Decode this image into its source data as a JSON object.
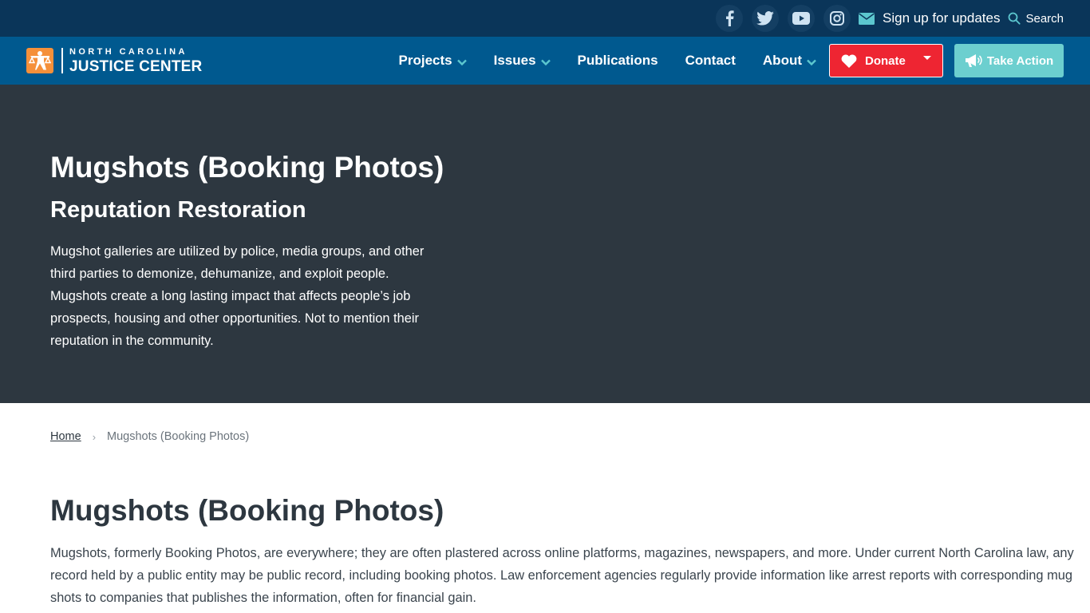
{
  "topbar": {
    "social": [
      {
        "name": "facebook-icon",
        "label": "Facebook"
      },
      {
        "name": "twitter-icon",
        "label": "Twitter"
      },
      {
        "name": "youtube-icon",
        "label": "YouTube"
      },
      {
        "name": "instagram-icon",
        "label": "Instagram"
      }
    ],
    "signup_label": "Sign up for updates",
    "search_label": "Search"
  },
  "header": {
    "logo_top": "NORTH CAROLINA",
    "logo_bottom": "JUSTICE CENTER",
    "nav": [
      {
        "label": "Projects",
        "dropdown": true
      },
      {
        "label": "Issues",
        "dropdown": true
      },
      {
        "label": "Publications",
        "dropdown": false
      },
      {
        "label": "Contact",
        "dropdown": false
      },
      {
        "label": "About",
        "dropdown": true
      }
    ],
    "donate_label": "Donate",
    "take_action_label": "Take Action",
    "colors": {
      "donate": "#ee2532",
      "take_action": "#6ccfcf",
      "accent": "#5cc7cf"
    }
  },
  "hero": {
    "title": "Mugshots (Booking Photos)",
    "subtitle": "Reputation Restoration",
    "description": "Mugshot galleries are utilized by police, media groups, and other third parties to demonize, dehumanize, and exploit people. Mugshots create a long lasting impact that affects people’s job prospects, housing and other opportunities. Not to mention their reputation in the community."
  },
  "breadcrumb": {
    "home": "Home",
    "separator": "›",
    "current": "Mugshots (Booking Photos)"
  },
  "main": {
    "title": "Mugshots (Booking Photos)",
    "paragraph_lines": [
      "Mugshots, formerly Booking Photos, are everywhere; they are often plastered across online platforms, magazines, newspapers, and more. Under current North Carolina law, any",
      "record held by a public entity may be public record, including booking photos. Law enforcement agencies regularly provide information like arrest reports with corresponding mug",
      "shots to companies that publishes the information, often for financial gain."
    ]
  }
}
